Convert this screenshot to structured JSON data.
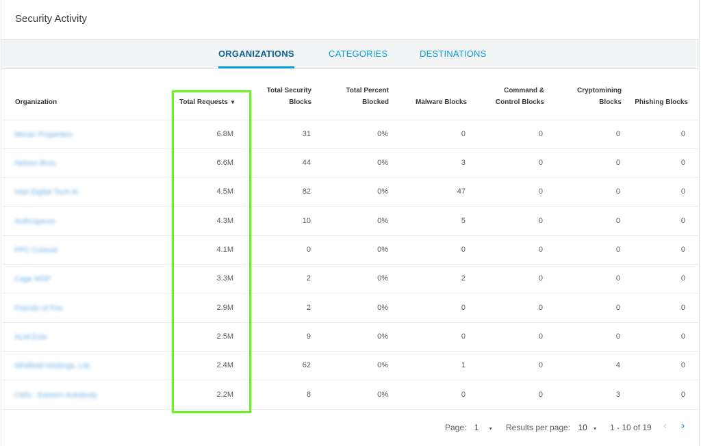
{
  "panel": {
    "title": "Security Activity"
  },
  "tabs": [
    {
      "label": "ORGANIZATIONS",
      "active": true
    },
    {
      "label": "CATEGORIES",
      "active": false
    },
    {
      "label": "DESTINATIONS",
      "active": false
    }
  ],
  "table": {
    "headers": {
      "organization": "Organization",
      "total_requests": "Total Requests",
      "sort_indicator": "▾",
      "total_security_blocks": [
        "Total Security",
        "Blocks"
      ],
      "total_percent_blocked": [
        "Total Percent",
        "Blocked"
      ],
      "malware_blocks": "Malware Blocks",
      "command_control_blocks": [
        "Command &",
        "Control Blocks"
      ],
      "cryptomining_blocks": [
        "Cryptomining",
        "Blocks"
      ],
      "phishing_blocks": "Phishing Blocks"
    },
    "rows": [
      {
        "org": "Moran Properties",
        "requests": "6.8M",
        "security": "31",
        "percent": "0%",
        "malware": "0",
        "cnc": "0",
        "crypto": "0",
        "phishing": "0"
      },
      {
        "org": "Nelson Bros.",
        "requests": "6.6M",
        "security": "44",
        "percent": "0%",
        "malware": "3",
        "cnc": "0",
        "crypto": "0",
        "phishing": "0"
      },
      {
        "org": "Intel Digital Tech AI",
        "requests": "4.5M",
        "security": "82",
        "percent": "0%",
        "malware": "47",
        "cnc": "0",
        "crypto": "0",
        "phishing": "0"
      },
      {
        "org": "Anthropeum",
        "requests": "4.3M",
        "security": "10",
        "percent": "0%",
        "malware": "5",
        "cnc": "0",
        "crypto": "0",
        "phishing": "0"
      },
      {
        "org": "PPC Colonel",
        "requests": "4.1M",
        "security": "0",
        "percent": "0%",
        "malware": "0",
        "cnc": "0",
        "crypto": "0",
        "phishing": "0"
      },
      {
        "org": "Cage MSP",
        "requests": "3.3M",
        "security": "2",
        "percent": "0%",
        "malware": "2",
        "cnc": "0",
        "crypto": "0",
        "phishing": "0"
      },
      {
        "org": "Friends of Fire",
        "requests": "2.9M",
        "security": "2",
        "percent": "0%",
        "malware": "0",
        "cnc": "0",
        "crypto": "0",
        "phishing": "0"
      },
      {
        "org": "ALM Ents",
        "requests": "2.5M",
        "security": "9",
        "percent": "0%",
        "malware": "0",
        "cnc": "0",
        "crypto": "0",
        "phishing": "0"
      },
      {
        "org": "Whitfield Holdings, Ltd.",
        "requests": "2.4M",
        "security": "62",
        "percent": "0%",
        "malware": "1",
        "cnc": "0",
        "crypto": "4",
        "phishing": "0"
      },
      {
        "org": "CMS - Eastern Autobody",
        "requests": "2.2M",
        "security": "8",
        "percent": "0%",
        "malware": "0",
        "cnc": "0",
        "crypto": "3",
        "phishing": "0"
      }
    ]
  },
  "pagination": {
    "page_label": "Page:",
    "page_value": "1",
    "results_label": "Results per page:",
    "results_value": "10",
    "range": "1 - 10 of 19",
    "caret": "▾",
    "prev_icon": "‹",
    "next_icon": "›"
  },
  "colors": {
    "accent": "#049fd9",
    "active_tab": "#0f6396",
    "highlight": "#6ff02d"
  }
}
